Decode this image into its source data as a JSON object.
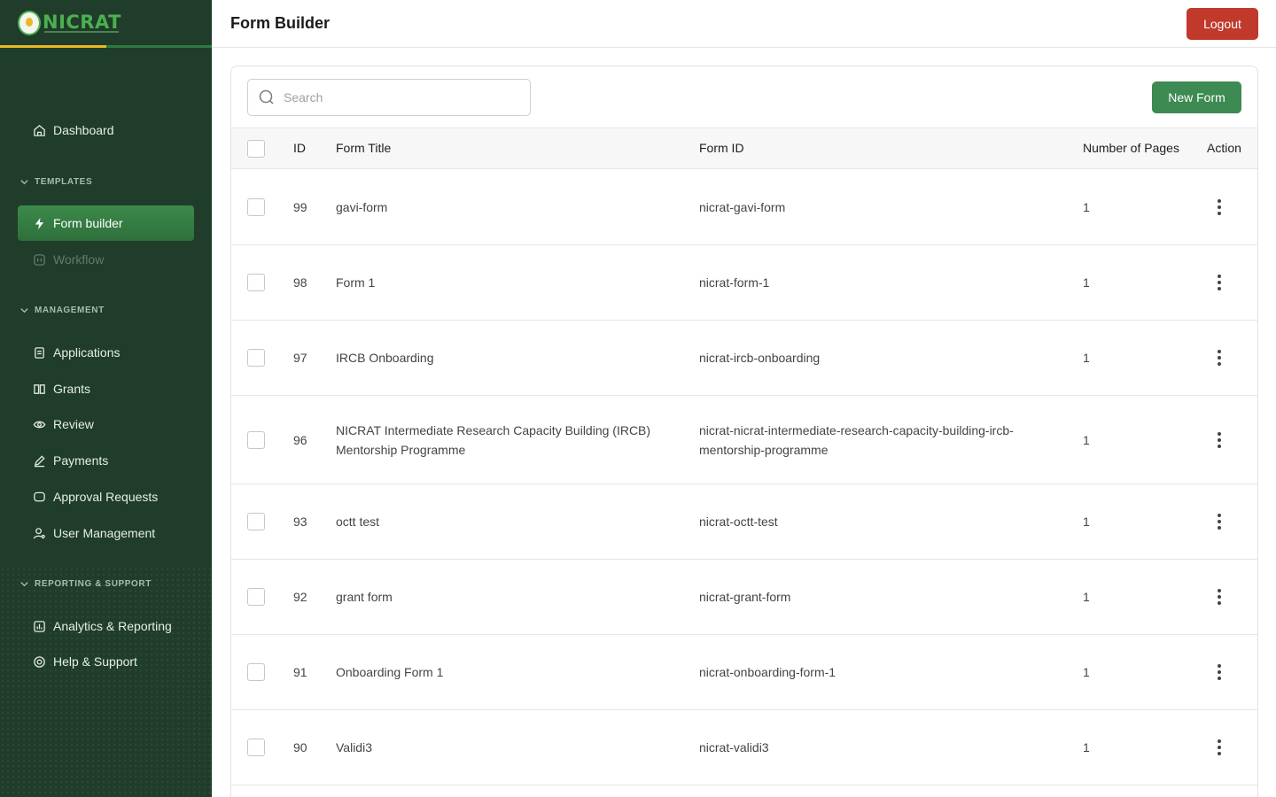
{
  "app": {
    "logo_text": "NICRAT"
  },
  "sidebar": {
    "dashboard": "Dashboard",
    "templates_label": "TEMPLATES",
    "form_builder": "Form builder",
    "workflow": "Workflow",
    "management_label": "MANAGEMENT",
    "applications": "Applications",
    "grants": "Grants",
    "review": "Review",
    "payments": "Payments",
    "approval_requests": "Approval Requests",
    "user_management": "User Management",
    "reporting_label": "REPORTING & SUPPORT",
    "analytics": "Analytics & Reporting",
    "help": "Help & Support"
  },
  "header": {
    "title": "Form Builder",
    "logout_label": "Logout"
  },
  "toolbar": {
    "search_placeholder": "Search",
    "new_form_label": "New Form"
  },
  "table": {
    "headers": {
      "id": "ID",
      "title": "Form Title",
      "form_id": "Form ID",
      "pages": "Number of Pages",
      "action": "Action"
    },
    "rows": [
      {
        "id": "99",
        "title": "gavi-form",
        "form_id": "nicrat-gavi-form",
        "pages": "1"
      },
      {
        "id": "98",
        "title": "Form 1",
        "form_id": "nicrat-form-1",
        "pages": "1"
      },
      {
        "id": "97",
        "title": "IRCB Onboarding",
        "form_id": "nicrat-ircb-onboarding",
        "pages": "1"
      },
      {
        "id": "96",
        "title": "NICRAT Intermediate Research Capacity Building (IRCB) Mentorship Programme",
        "form_id": "nicrat-nicrat-intermediate-research-capacity-building-ircb-mentorship-programme",
        "pages": "1"
      },
      {
        "id": "93",
        "title": "octt test",
        "form_id": "nicrat-octt-test",
        "pages": "1"
      },
      {
        "id": "92",
        "title": "grant form",
        "form_id": "nicrat-grant-form",
        "pages": "1"
      },
      {
        "id": "91",
        "title": "Onboarding Form 1",
        "form_id": "nicrat-onboarding-form-1",
        "pages": "1"
      },
      {
        "id": "90",
        "title": "Validi3",
        "form_id": "nicrat-validi3",
        "pages": "1"
      }
    ]
  },
  "colors": {
    "sidebar_bg": "#1f3d2a",
    "accent_green": "#3d8a52",
    "logout_red": "#c0392b",
    "logo_yellow": "#e8b923"
  }
}
